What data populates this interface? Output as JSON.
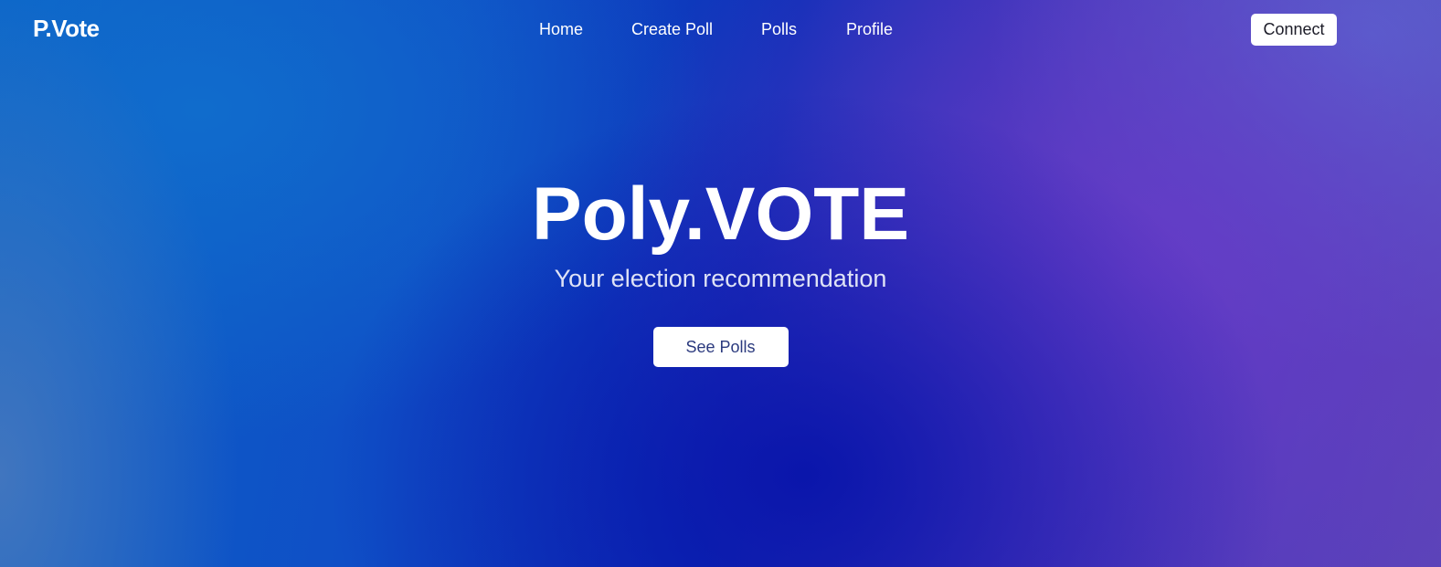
{
  "header": {
    "logo": "P.Vote",
    "nav": {
      "home": "Home",
      "create_poll": "Create Poll",
      "polls": "Polls",
      "profile": "Profile"
    },
    "connect_label": "Connect"
  },
  "hero": {
    "title": "Poly.VOTE",
    "subtitle": "Your election recommendation",
    "cta_label": "See Polls"
  },
  "colors": {
    "background_start": "#0d63c6",
    "background_mid": "#0e2fb8",
    "background_end": "#5a45b6",
    "button_bg": "#ffffff",
    "cta_text": "#2b3a7e"
  }
}
